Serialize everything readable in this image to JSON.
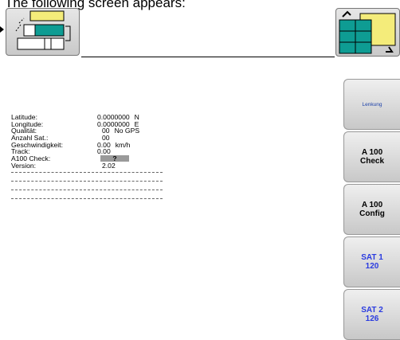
{
  "caption": "The following screen appears:",
  "info": {
    "rows": [
      {
        "label": "Latitude:",
        "value": "0.0000000",
        "unit": "N"
      },
      {
        "label": "Longitude:",
        "value": "0.0000000",
        "unit": "E"
      },
      {
        "label": "Qualität:",
        "value": "00",
        "unit": "No GPS"
      },
      {
        "label": "Anzahl Sat.:",
        "value": "00",
        "unit": ""
      },
      {
        "label": "Geschwindigkeit:",
        "value": "0.00",
        "unit": "km/h"
      },
      {
        "label": "Track:",
        "value": "0.00",
        "unit": ""
      },
      {
        "label": "A100 Check:",
        "value": "?",
        "unit": ""
      },
      {
        "label": "Version:",
        "value": "2.02",
        "unit": ""
      }
    ]
  },
  "sidebar": {
    "items": [
      {
        "label": "Lenkung"
      },
      {
        "label": "A 100\nCheck"
      },
      {
        "label": "A 100\nConfig"
      },
      {
        "label": "SAT 1\n120"
      },
      {
        "label": "SAT 2\n126"
      }
    ]
  },
  "colors": {
    "teal": "#0e9c93",
    "yellow": "#f4ec7a",
    "blue_text": "#2a3be0"
  }
}
